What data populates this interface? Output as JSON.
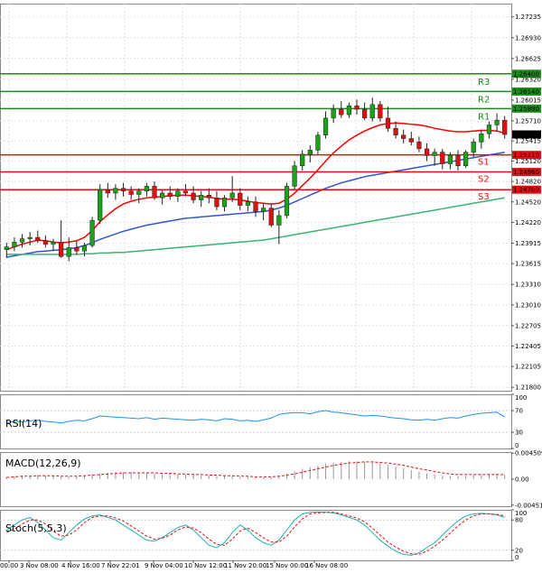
{
  "chart_data": {
    "type": "candlestick",
    "title": "",
    "price_ylim": [
      1.2175,
      1.2743
    ],
    "price_ticks": [
      "1.27235",
      "1.26930",
      "1.26625",
      "1.26320",
      "1.26015",
      "1.25710",
      "1.25415",
      "1.25120",
      "1.24820",
      "1.24520",
      "1.24220",
      "1.23915",
      "1.23615",
      "1.23310",
      "1.23010",
      "1.22705",
      "1.22405",
      "1.22105",
      "1.21800"
    ],
    "current_price": "1.25510",
    "time_labels": [
      "00:00",
      "3 Nov 08:00",
      "4 Nov 16:00",
      "7 Nov 22:01",
      "9 Nov 04:00",
      "10 Nov 12:00",
      "11 Nov 20:00",
      "15 Nov 00:00",
      "16 Nov 08:00"
    ],
    "levels": [
      {
        "id": "R3",
        "label": "R3",
        "value": 1.264,
        "tag": "1.26400",
        "color": "#1a8a1a"
      },
      {
        "id": "R2",
        "label": "R2",
        "value": 1.2614,
        "tag": "1.26140",
        "color": "#1a8a1a"
      },
      {
        "id": "R1",
        "label": "R1",
        "value": 1.2589,
        "tag": "1.25890",
        "color": "#1a8a1a"
      },
      {
        "id": "S1",
        "label": "S1",
        "value": 1.2521,
        "tag": "1.25210",
        "color": "#e01010"
      },
      {
        "id": "S2",
        "label": "S2",
        "value": 1.2496,
        "tag": "1.24960",
        "color": "#e01010"
      },
      {
        "id": "S3",
        "label": "S3",
        "value": 1.247,
        "tag": "1.24700",
        "color": "#e01010"
      }
    ],
    "candles": [
      [
        1.2382,
        1.2392,
        1.237,
        1.2386
      ],
      [
        1.2386,
        1.24,
        1.238,
        1.2393
      ],
      [
        1.2393,
        1.2405,
        1.2385,
        1.2398
      ],
      [
        1.2398,
        1.2408,
        1.2388,
        1.24
      ],
      [
        1.24,
        1.241,
        1.2392,
        1.2395
      ],
      [
        1.2395,
        1.2403,
        1.2385,
        1.239
      ],
      [
        1.239,
        1.2398,
        1.238,
        1.2393
      ],
      [
        1.2393,
        1.2425,
        1.237,
        1.2372
      ],
      [
        1.2372,
        1.24,
        1.2365,
        1.2385
      ],
      [
        1.2385,
        1.2395,
        1.2375,
        1.238
      ],
      [
        1.238,
        1.2392,
        1.2372,
        1.2388
      ],
      [
        1.2388,
        1.243,
        1.2385,
        1.2425
      ],
      [
        1.2425,
        1.2478,
        1.242,
        1.247
      ],
      [
        1.247,
        1.248,
        1.2458,
        1.2465
      ],
      [
        1.2465,
        1.2478,
        1.2455,
        1.2472
      ],
      [
        1.2472,
        1.248,
        1.246,
        1.2468
      ],
      [
        1.2468,
        1.2475,
        1.2455,
        1.2463
      ],
      [
        1.2463,
        1.2472,
        1.245,
        1.2468
      ],
      [
        1.2468,
        1.248,
        1.246,
        1.2475
      ],
      [
        1.2475,
        1.2482,
        1.2455,
        1.2458
      ],
      [
        1.2458,
        1.247,
        1.2448,
        1.2465
      ],
      [
        1.2465,
        1.2475,
        1.2455,
        1.246
      ],
      [
        1.246,
        1.2472,
        1.2452,
        1.2468
      ],
      [
        1.2468,
        1.2478,
        1.246,
        1.2465
      ],
      [
        1.2465,
        1.2475,
        1.245,
        1.2455
      ],
      [
        1.2455,
        1.2468,
        1.2445,
        1.2462
      ],
      [
        1.2462,
        1.2472,
        1.245,
        1.2458
      ],
      [
        1.2458,
        1.2468,
        1.244,
        1.2445
      ],
      [
        1.2445,
        1.2462,
        1.2438,
        1.2458
      ],
      [
        1.2458,
        1.249,
        1.2452,
        1.2465
      ],
      [
        1.2465,
        1.2472,
        1.244,
        1.2447
      ],
      [
        1.2447,
        1.246,
        1.2438,
        1.2452
      ],
      [
        1.2452,
        1.246,
        1.243,
        1.2438
      ],
      [
        1.2438,
        1.245,
        1.2425,
        1.2443
      ],
      [
        1.2443,
        1.245,
        1.2415,
        1.2418
      ],
      [
        1.2418,
        1.244,
        1.239,
        1.2432
      ],
      [
        1.2432,
        1.248,
        1.2428,
        1.2475
      ],
      [
        1.2475,
        1.2512,
        1.247,
        1.2505
      ],
      [
        1.2505,
        1.2528,
        1.2498,
        1.2522
      ],
      [
        1.2522,
        1.2535,
        1.251,
        1.2528
      ],
      [
        1.2528,
        1.2555,
        1.2522,
        1.255
      ],
      [
        1.255,
        1.2585,
        1.2545,
        1.2575
      ],
      [
        1.2575,
        1.2595,
        1.2568,
        1.2588
      ],
      [
        1.2588,
        1.26,
        1.2575,
        1.258
      ],
      [
        1.258,
        1.2598,
        1.2575,
        1.2593
      ],
      [
        1.2593,
        1.2602,
        1.258,
        1.2588
      ],
      [
        1.2588,
        1.2598,
        1.2572,
        1.2575
      ],
      [
        1.2575,
        1.2605,
        1.257,
        1.2595
      ],
      [
        1.2595,
        1.26,
        1.257,
        1.2575
      ],
      [
        1.2575,
        1.2592,
        1.2555,
        1.256
      ],
      [
        1.256,
        1.257,
        1.2545,
        1.255
      ],
      [
        1.255,
        1.2558,
        1.2538,
        1.2545
      ],
      [
        1.2545,
        1.2555,
        1.2535,
        1.254
      ],
      [
        1.254,
        1.2548,
        1.2525,
        1.253
      ],
      [
        1.253,
        1.2538,
        1.2512,
        1.252
      ],
      [
        1.252,
        1.253,
        1.2505,
        1.2525
      ],
      [
        1.2525,
        1.253,
        1.25,
        1.2508
      ],
      [
        1.2508,
        1.2525,
        1.25,
        1.252
      ],
      [
        1.252,
        1.2528,
        1.2498,
        1.2505
      ],
      [
        1.2505,
        1.2528,
        1.2502,
        1.2525
      ],
      [
        1.2525,
        1.2545,
        1.2518,
        1.254
      ],
      [
        1.254,
        1.2558,
        1.253,
        1.2552
      ],
      [
        1.2552,
        1.257,
        1.2545,
        1.2565
      ],
      [
        1.2565,
        1.2582,
        1.2555,
        1.2572
      ],
      [
        1.2572,
        1.2578,
        1.2545,
        1.2551
      ]
    ],
    "ma_series": [
      {
        "color": "#ff0000",
        "values": [
          1.2382,
          1.2386,
          1.239,
          1.2393,
          1.2396,
          1.2395,
          1.2393,
          1.2392,
          1.2393,
          1.2395,
          1.24,
          1.241,
          1.2423,
          1.2433,
          1.2442,
          1.2449,
          1.2453,
          1.2456,
          1.2458,
          1.2459,
          1.246,
          1.2461,
          1.2462,
          1.2462,
          1.2461,
          1.246,
          1.2459,
          1.2457,
          1.2456,
          1.2456,
          1.2455,
          1.2453,
          1.2451,
          1.245,
          1.2449,
          1.245,
          1.2456,
          1.2465,
          1.2476,
          1.2487,
          1.2499,
          1.2512,
          1.2524,
          1.2534,
          1.2543,
          1.255,
          1.2556,
          1.2561,
          1.2565,
          1.2567,
          1.2568,
          1.2567,
          1.2566,
          1.2565,
          1.2563,
          1.256,
          1.2558,
          1.2556,
          1.2555,
          1.2555,
          1.2556,
          1.2557,
          1.2557,
          1.2556,
          1.2553
        ]
      },
      {
        "color": "#3355cc",
        "values": [
          1.2371,
          1.2373,
          1.2375,
          1.2377,
          1.2379,
          1.238,
          1.2381,
          1.2382,
          1.2383,
          1.2385,
          1.2388,
          1.2392,
          1.2397,
          1.2401,
          1.2405,
          1.2409,
          1.2412,
          1.2415,
          1.2418,
          1.242,
          1.2422,
          1.2424,
          1.2426,
          1.2428,
          1.2429,
          1.243,
          1.2431,
          1.2432,
          1.2433,
          1.2434,
          1.2435,
          1.2436,
          1.2437,
          1.2438,
          1.244,
          1.2443,
          1.2447,
          1.2452,
          1.2457,
          1.2462,
          1.2467,
          1.2472,
          1.2476,
          1.248,
          1.2483,
          1.2486,
          1.2489,
          1.2491,
          1.2493,
          1.2495,
          1.2497,
          1.2499,
          1.2501,
          1.2503,
          1.2505,
          1.2507,
          1.2509,
          1.2511,
          1.2513,
          1.2515,
          1.2517,
          1.2519,
          1.2521,
          1.2523,
          1.2525
        ]
      },
      {
        "color": "#3cb371",
        "values": [
          1.2375,
          1.2375,
          1.2375,
          1.2375,
          1.2375,
          1.2375,
          1.2375,
          1.2375,
          1.2375,
          1.2375,
          1.2376,
          1.2376,
          1.2377,
          1.2377,
          1.2378,
          1.2378,
          1.2379,
          1.238,
          1.2381,
          1.2382,
          1.2383,
          1.2384,
          1.2385,
          1.2386,
          1.2387,
          1.2388,
          1.2389,
          1.239,
          1.2391,
          1.2392,
          1.2393,
          1.2394,
          1.2395,
          1.2396,
          1.2398,
          1.24,
          1.2402,
          1.2404,
          1.2406,
          1.2408,
          1.241,
          1.2412,
          1.2414,
          1.2416,
          1.2418,
          1.242,
          1.2422,
          1.2424,
          1.2426,
          1.2428,
          1.243,
          1.2432,
          1.2434,
          1.2436,
          1.2438,
          1.244,
          1.2442,
          1.2444,
          1.2446,
          1.2448,
          1.245,
          1.2452,
          1.2454,
          1.2456,
          1.2458
        ]
      }
    ],
    "rsi": {
      "label": "RSI(14)",
      "ticks": [
        "100",
        "70",
        "30",
        "0"
      ],
      "values": [
        48,
        50,
        49,
        51,
        52,
        50,
        49,
        47,
        50,
        52,
        51,
        55,
        60,
        59,
        58,
        57,
        56,
        55,
        57,
        54,
        56,
        55,
        54,
        53,
        52,
        54,
        53,
        51,
        55,
        54,
        51,
        52,
        50,
        53,
        56,
        63,
        65,
        66,
        66,
        64,
        68,
        70,
        67,
        66,
        64,
        62,
        60,
        61,
        60,
        58,
        56,
        55,
        53,
        52,
        54,
        52,
        55,
        57,
        56,
        60,
        63,
        65,
        66,
        67,
        58
      ]
    },
    "macd": {
      "label": "MACD(12,26,9)",
      "ticks": [
        "0.004509",
        "0.00",
        "-0.004512"
      ],
      "ylim": [
        -0.0047,
        0.0047
      ],
      "hist": [
        0.0004,
        0.0005,
        0.0006,
        0.0006,
        0.0007,
        0.0006,
        0.0005,
        0.0004,
        0.0004,
        0.0005,
        0.0006,
        0.0008,
        0.001,
        0.0011,
        0.0012,
        0.0012,
        0.0012,
        0.0011,
        0.0011,
        0.001,
        0.0009,
        0.0009,
        0.0008,
        0.0008,
        0.0007,
        0.0006,
        0.0006,
        0.0005,
        0.0005,
        0.0005,
        0.0004,
        0.0004,
        0.0003,
        0.0003,
        0.0004,
        0.0006,
        0.001,
        0.0014,
        0.0018,
        0.0021,
        0.0024,
        0.0027,
        0.0029,
        0.003,
        0.0031,
        0.0031,
        0.003,
        0.0029,
        0.0027,
        0.0025,
        0.0022,
        0.0019,
        0.0016,
        0.0013,
        0.001,
        0.0008,
        0.0006,
        0.0005,
        0.0005,
        0.0006,
        0.0007,
        0.0008,
        0.0009,
        0.0009,
        0.0008
      ],
      "signal": [
        0.0003,
        0.0004,
        0.0005,
        0.0005,
        0.0006,
        0.0006,
        0.0006,
        0.0005,
        0.0005,
        0.0005,
        0.0006,
        0.0007,
        0.0008,
        0.0009,
        0.001,
        0.0011,
        0.0011,
        0.0011,
        0.0011,
        0.0011,
        0.001,
        0.001,
        0.0009,
        0.0009,
        0.0008,
        0.0008,
        0.0007,
        0.0007,
        0.0006,
        0.0006,
        0.0005,
        0.0005,
        0.0004,
        0.0004,
        0.0004,
        0.0005,
        0.0007,
        0.0009,
        0.0012,
        0.0015,
        0.0018,
        0.0021,
        0.0024,
        0.0026,
        0.0028,
        0.0029,
        0.003,
        0.003,
        0.0029,
        0.0028,
        0.0026,
        0.0024,
        0.0021,
        0.0018,
        0.0016,
        0.0013,
        0.0011,
        0.0009,
        0.0008,
        0.0008,
        0.0008,
        0.0008,
        0.0008,
        0.0008,
        0.0008
      ]
    },
    "stoch": {
      "label": "Stoch(5,5,3)",
      "ticks": [
        "100",
        "80",
        "20",
        "0"
      ],
      "k": [
        60,
        70,
        80,
        85,
        75,
        60,
        45,
        40,
        55,
        70,
        82,
        88,
        90,
        85,
        80,
        70,
        60,
        50,
        40,
        38,
        45,
        55,
        65,
        70,
        60,
        45,
        30,
        25,
        35,
        55,
        70,
        60,
        45,
        35,
        30,
        40,
        60,
        80,
        92,
        95,
        96,
        95,
        94,
        90,
        85,
        80,
        70,
        55,
        40,
        28,
        18,
        12,
        10,
        15,
        25,
        35,
        50,
        65,
        78,
        88,
        92,
        93,
        92,
        90,
        85
      ],
      "d": [
        55,
        62,
        72,
        80,
        80,
        72,
        58,
        48,
        50,
        60,
        75,
        85,
        88,
        88,
        84,
        78,
        68,
        58,
        48,
        42,
        44,
        50,
        60,
        66,
        64,
        55,
        42,
        32,
        30,
        42,
        58,
        64,
        55,
        45,
        36,
        36,
        48,
        66,
        82,
        92,
        94,
        95,
        95,
        92,
        88,
        84,
        76,
        64,
        50,
        36,
        26,
        18,
        13,
        12,
        18,
        28,
        40,
        54,
        68,
        80,
        88,
        92,
        92,
        91,
        88
      ]
    }
  }
}
